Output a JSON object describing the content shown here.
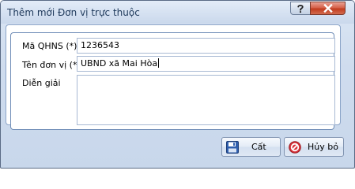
{
  "window": {
    "title": "Thêm mới Đơn vị trực thuộc"
  },
  "form": {
    "ma_qhns_label": "Mã QHNS (*)",
    "ma_qhns_value": "1236543",
    "ten_don_vi_label": "Tên đơn vị (*)",
    "ten_don_vi_value": "UBND xã Mai Hòa",
    "dien_giai_label": "Diễn giải",
    "dien_giai_value": ""
  },
  "buttons": {
    "save_label": "Cất",
    "cancel_label": "Hủy bỏ"
  },
  "icons": {
    "help": "question-mark-icon",
    "close": "close-x-icon",
    "save": "floppy-disk-icon",
    "cancel": "no-entry-icon"
  },
  "colors": {
    "title_text": "#1e395b",
    "close_button": "#c23c20",
    "cancel_icon": "#d9323a"
  }
}
